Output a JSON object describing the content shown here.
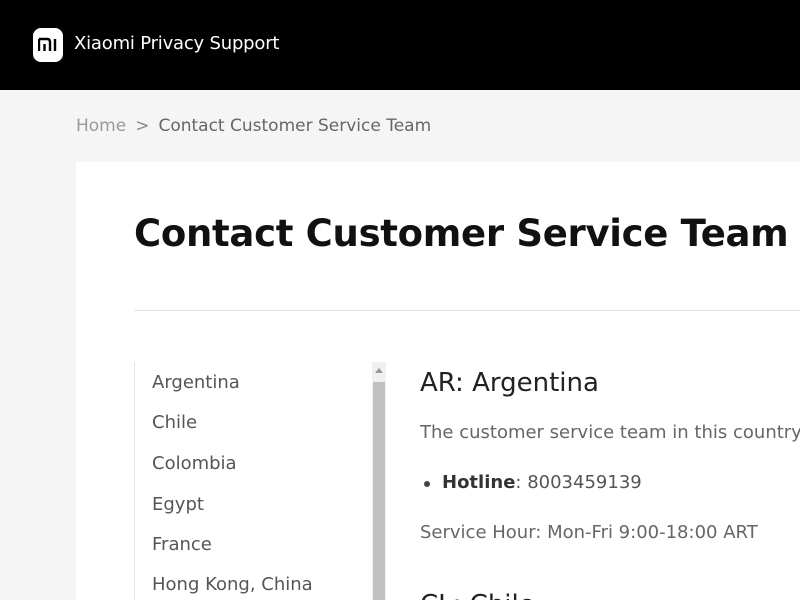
{
  "header": {
    "brand": "Xiaomi Privacy Support",
    "logo_icon": "mi-logo-icon"
  },
  "breadcrumb": {
    "home": "Home",
    "separator": ">",
    "current": "Contact Customer Service Team"
  },
  "main": {
    "title": "Contact Customer Service Team",
    "countries": [
      "Argentina",
      "Chile",
      "Colombia",
      "Egypt",
      "France",
      "Hong Kong, China"
    ],
    "detail": {
      "heading": "AR: Argentina",
      "description": "The customer service team in this country / reg",
      "hotline_label": "Hotline",
      "hotline_sep": ": ",
      "hotline_value": "8003459139",
      "service_hour": "Service Hour: Mon-Fri 9:00-18:00 ART",
      "next_heading": "CL: Chile"
    }
  },
  "colors": {
    "header_bg": "#000000",
    "page_bg": "#f5f5f6",
    "card_bg": "#ffffff"
  }
}
